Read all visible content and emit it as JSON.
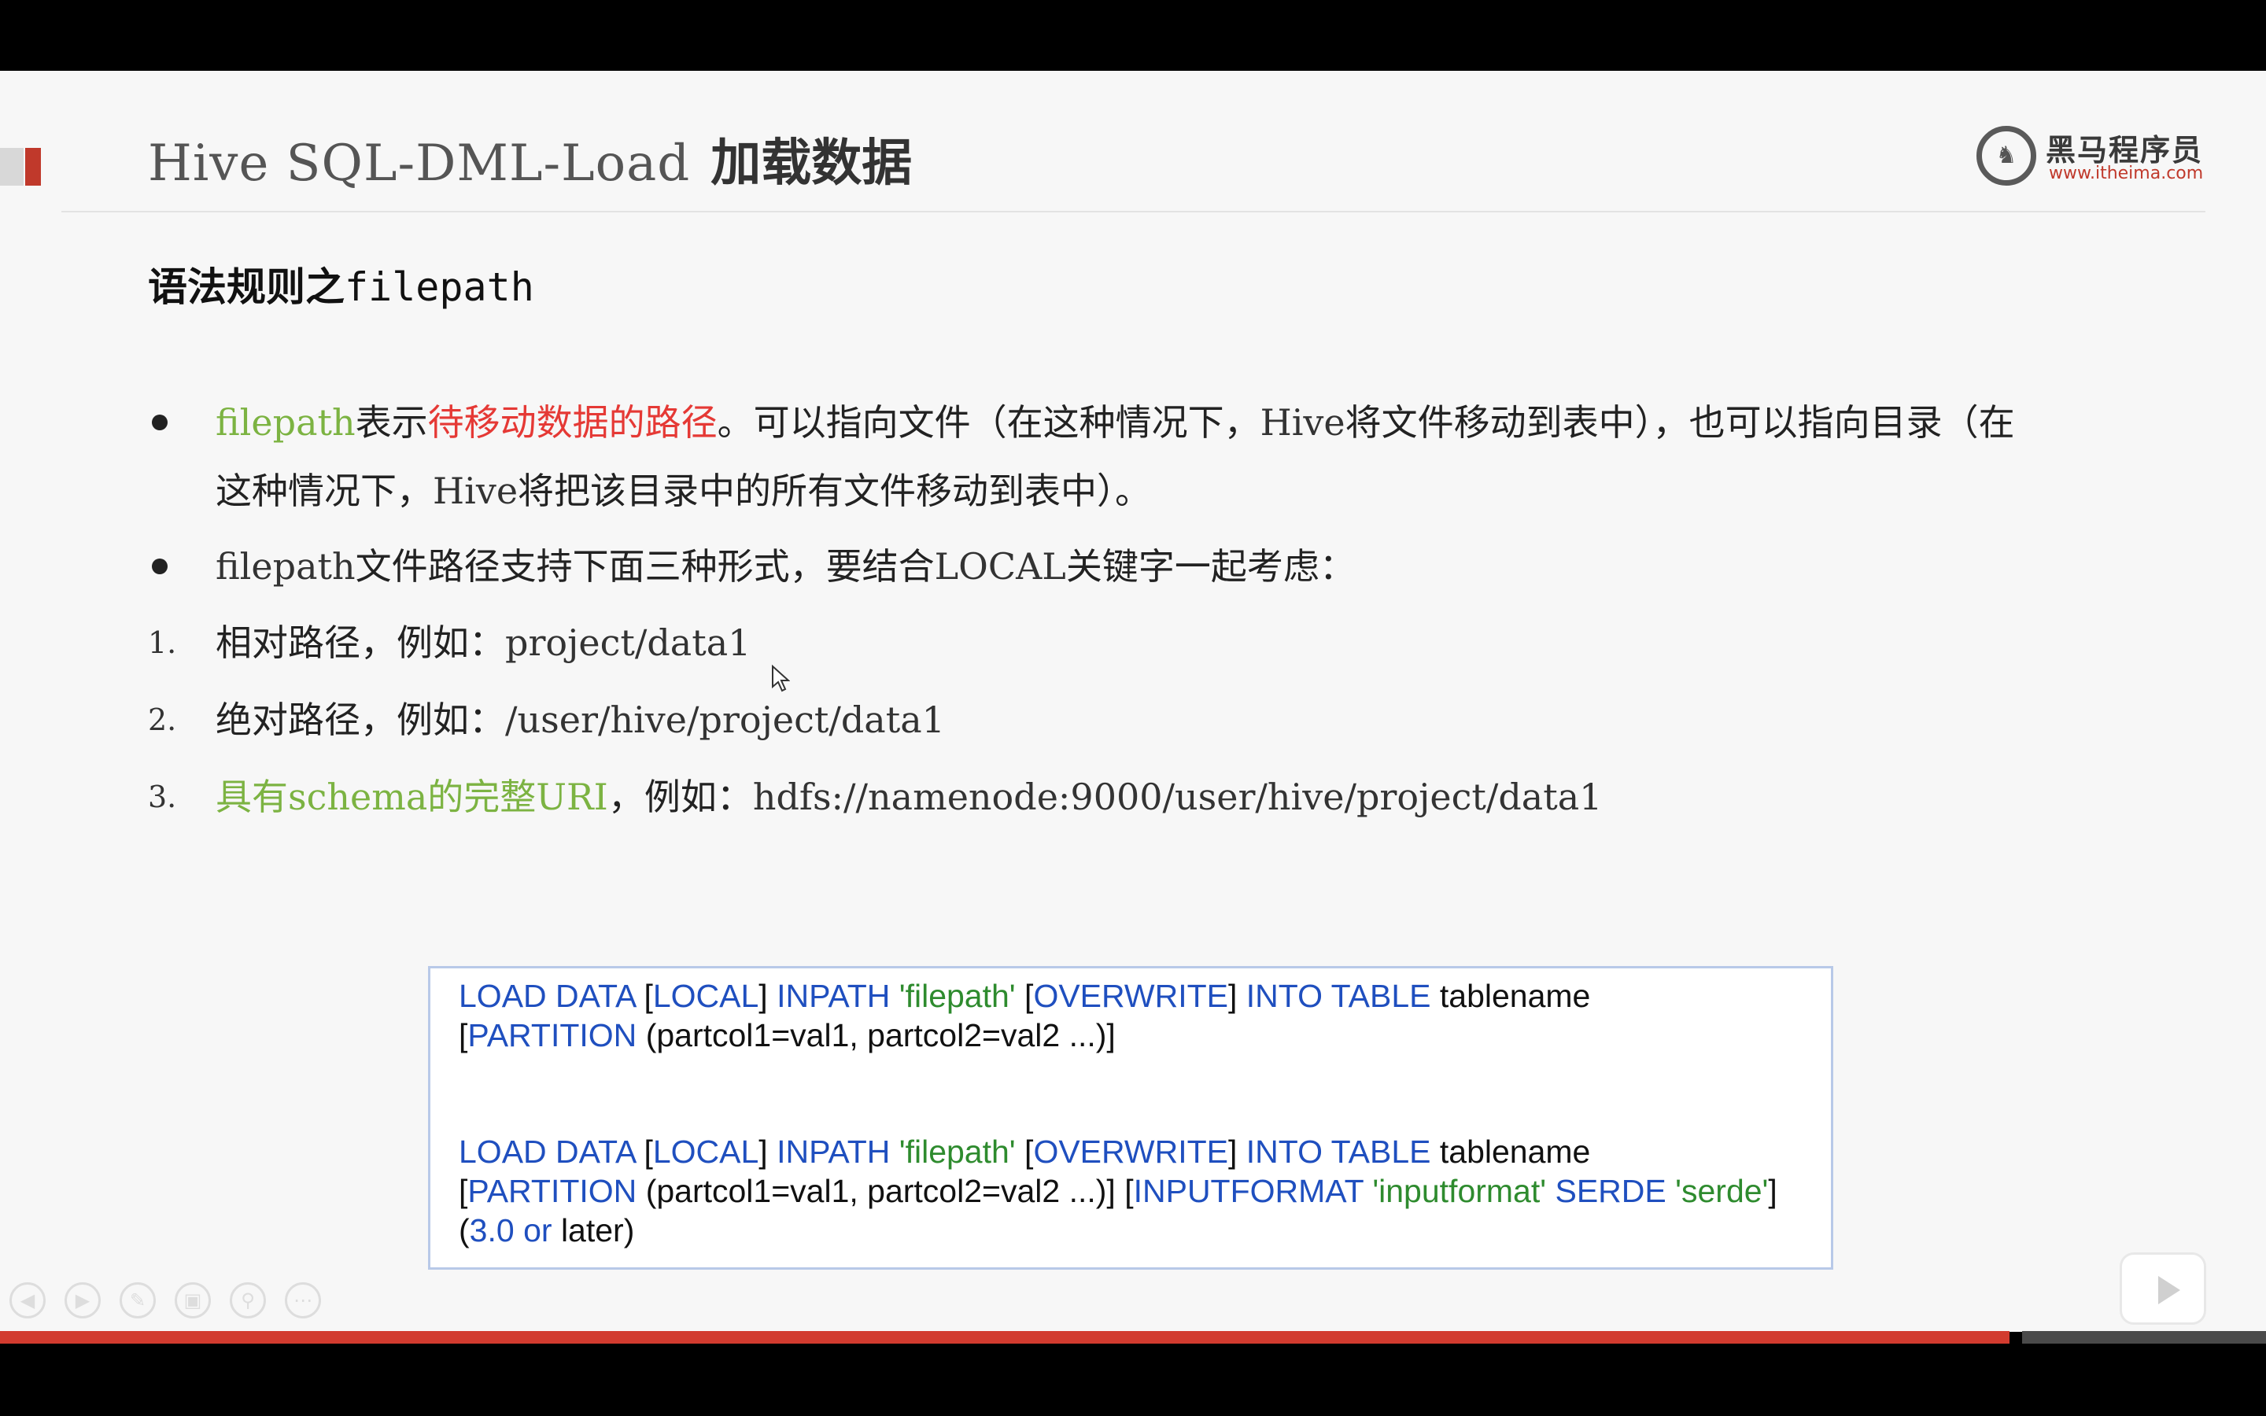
{
  "slide": {
    "title_en": "Hive SQL-DML-Load",
    "title_zh": "加载数据",
    "section_title_zh": "语法规则之",
    "section_title_code": "filepath"
  },
  "logo": {
    "name": "黑马程序员",
    "url": "www.itheima.com"
  },
  "bullets": [
    {
      "term": "filepath",
      "t1": "表示",
      "highlight": "待移动数据的路径",
      "t2": "。可以指向文件（在这种情况下，",
      "hive1": "Hive",
      "t3": "将文件移动到表中），也可以指向目录（在",
      "cont1": "这种情况下，",
      "hive2": "Hive",
      "cont2": "将把该目录中的所有文件移动到表中）。"
    },
    {
      "term": "filepath",
      "t1": "文件路径支持下面三种形式，要结合",
      "local": "LOCAL",
      "t2": "关键字一起考虑："
    }
  ],
  "numbered": [
    {
      "num": "1.",
      "label": "相对路径，例如：",
      "example": "project/data1"
    },
    {
      "num": "2.",
      "label": "绝对路径，例如：",
      "example": "/user/hive/project/data1"
    },
    {
      "num": "3.",
      "label_a": "具有",
      "label_b": "schema",
      "label_c": "的完整",
      "label_d": "URI",
      "label_e": "，例如：",
      "example": "hdfs://namenode:9000/user/hive/project/data1"
    }
  ],
  "code": {
    "load_data": "LOAD DATA",
    "local": "LOCAL",
    "inpath": "INPATH",
    "filepath": "'filepath'",
    "overwrite": "OVERWRITE",
    "into_table": "INTO TABLE",
    "tablename": "tablename",
    "partition": "PARTITION",
    "partcols": "(partcol1=val1, partcol2=val2 ...)]",
    "inputformat": "INPUTFORMAT",
    "inputformat_val": "'inputformat'",
    "serde": "SERDE",
    "serde_val": "'serde'",
    "version": "3.0",
    "or": "or",
    "later": "later)"
  },
  "controls": [
    "prev-icon",
    "next-icon",
    "pen-icon",
    "copy-icon",
    "zoom-icon",
    "more-icon"
  ],
  "colors": {
    "accent_red": "#c0392b",
    "keyword_blue": "#1f4fbf",
    "string_green": "#2e8b2e",
    "term_green": "#7cb342",
    "highlight_red": "#e53935"
  }
}
